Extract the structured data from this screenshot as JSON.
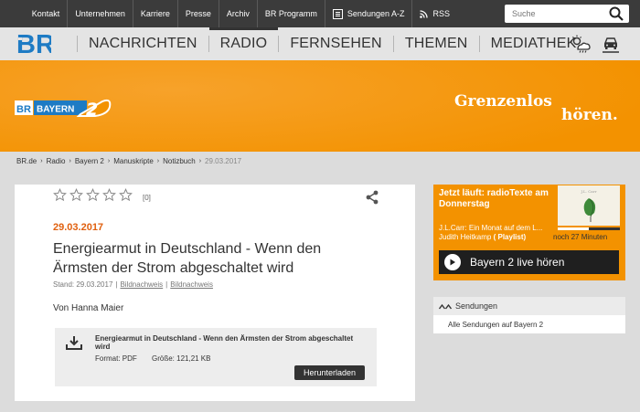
{
  "topnav": [
    "Kontakt",
    "Unternehmen",
    "Karriere",
    "Presse",
    "Archiv",
    "BR Programm",
    "Sendungen A-Z",
    "RSS"
  ],
  "search": {
    "placeholder": "Suche"
  },
  "header": {
    "logo": "BR",
    "nav": [
      {
        "label": "NACHRICHTEN",
        "active": false
      },
      {
        "label": "RADIO",
        "active": true
      },
      {
        "label": "FERNSEHEN",
        "active": false
      },
      {
        "label": "THEMEN",
        "active": false
      },
      {
        "label": "MEDIATHEK",
        "active": false
      }
    ],
    "icons": [
      "weather-icon",
      "traffic-icon"
    ]
  },
  "banner": {
    "station_logo": "BR BAYERN 2",
    "slogan_line1": "Grenzenlos",
    "slogan_line2": "hören."
  },
  "breadcrumb": [
    "BR.de",
    "Radio",
    "Bayern 2",
    "Manuskripte",
    "Notizbuch",
    "29.03.2017"
  ],
  "article": {
    "rating_count": "[0]",
    "date": "29.03.2017",
    "title": "Energiearmut in Deutschland - Wenn den Ärmsten der Strom abgeschaltet wird",
    "stand": "Stand: 29.03.2017",
    "bild1": "Bildnachweis",
    "bild2": "Bildnachweis",
    "author": "Von Hanna Maier",
    "download": {
      "title": "Energiearmut in Deutschland - Wenn den Ärmsten der Strom abgeschaltet wird",
      "format": "Format: PDF",
      "size": "Größe: 121,21 KB",
      "button": "Herunterladen"
    }
  },
  "now_playing": {
    "label": "Jetzt läuft: radioTexte am Donnerstag",
    "line1": "J.L.Carr: Ein Monat auf dem L...",
    "line2_name": "Judith Heitkamp",
    "line2_link": "( Playlist)",
    "remaining": "noch 27 Minuten",
    "progress": 0.5,
    "live_button": "Bayern 2 live hören"
  },
  "sendungen": {
    "title": "Sendungen",
    "link": "Alle Sendungen auf Bayern 2"
  },
  "colors": {
    "orange": "#f39200",
    "date": "#e0600f",
    "dark": "#3b3b3b"
  }
}
